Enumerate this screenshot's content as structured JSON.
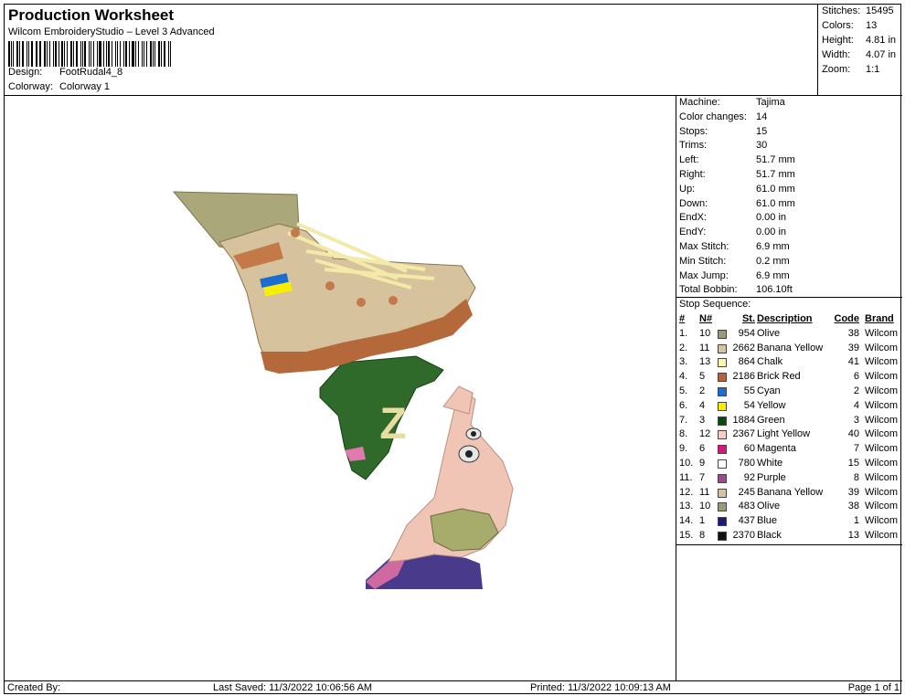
{
  "header": {
    "title": "Production Worksheet",
    "subtitle": "Wilcom EmbroideryStudio – Level 3 Advanced",
    "design_label": "Design:",
    "design_value": "FootRudal4_8",
    "colorway_label": "Colorway:",
    "colorway_value": "Colorway 1"
  },
  "stats": [
    {
      "label": "Stitches:",
      "value": "15495"
    },
    {
      "label": "Colors:",
      "value": "13"
    },
    {
      "label": "Height:",
      "value": "4.81 in"
    },
    {
      "label": "Width:",
      "value": "4.07 in"
    },
    {
      "label": "Zoom:",
      "value": "1:1"
    }
  ],
  "machine": [
    {
      "label": "Machine:",
      "value": "Tajima"
    },
    {
      "label": "Color changes:",
      "value": "14"
    },
    {
      "label": "Stops:",
      "value": "15"
    },
    {
      "label": "Trims:",
      "value": "30"
    },
    {
      "label": "Left:",
      "value": "51.7 mm"
    },
    {
      "label": "Right:",
      "value": "51.7 mm"
    },
    {
      "label": "Up:",
      "value": "61.0 mm"
    },
    {
      "label": "Down:",
      "value": "61.0 mm"
    },
    {
      "label": "EndX:",
      "value": "0.00 in"
    },
    {
      "label": "EndY:",
      "value": "0.00 in"
    },
    {
      "label": "Max Stitch:",
      "value": "6.9 mm"
    },
    {
      "label": "Min Stitch:",
      "value": "0.2 mm"
    },
    {
      "label": "Max Jump:",
      "value": "6.9 mm"
    },
    {
      "label": "Total Bobbin:",
      "value": "106.10ft"
    }
  ],
  "stop_sequence": {
    "title": "Stop Sequence:",
    "headers": {
      "num": "#",
      "n": "N#",
      "st": "St.",
      "desc": "Description",
      "code": "Code",
      "brand": "Brand"
    },
    "rows": [
      {
        "num": "1.",
        "n": "10",
        "color": "#9a9a78",
        "st": "954",
        "desc": "Olive",
        "code": "38",
        "brand": "Wilcom"
      },
      {
        "num": "2.",
        "n": "11",
        "color": "#d8c3a0",
        "st": "2662",
        "desc": "Banana Yellow",
        "code": "39",
        "brand": "Wilcom"
      },
      {
        "num": "3.",
        "n": "13",
        "color": "#fbf6a8",
        "st": "864",
        "desc": "Chalk",
        "code": "41",
        "brand": "Wilcom"
      },
      {
        "num": "4.",
        "n": "5",
        "color": "#b8643a",
        "st": "2186",
        "desc": "Brick Red",
        "code": "6",
        "brand": "Wilcom"
      },
      {
        "num": "5.",
        "n": "2",
        "color": "#1b6ed0",
        "st": "55",
        "desc": "Cyan",
        "code": "2",
        "brand": "Wilcom"
      },
      {
        "num": "6.",
        "n": "4",
        "color": "#f8ef00",
        "st": "54",
        "desc": "Yellow",
        "code": "4",
        "brand": "Wilcom"
      },
      {
        "num": "7.",
        "n": "3",
        "color": "#0a4a12",
        "st": "1884",
        "desc": "Green",
        "code": "3",
        "brand": "Wilcom"
      },
      {
        "num": "8.",
        "n": "12",
        "color": "#f7cdc6",
        "st": "2367",
        "desc": "Light Yellow",
        "code": "40",
        "brand": "Wilcom"
      },
      {
        "num": "9.",
        "n": "6",
        "color": "#d8157a",
        "st": "60",
        "desc": "Magenta",
        "code": "7",
        "brand": "Wilcom"
      },
      {
        "num": "10.",
        "n": "9",
        "color": "#ffffff",
        "st": "780",
        "desc": "White",
        "code": "15",
        "brand": "Wilcom"
      },
      {
        "num": "11.",
        "n": "7",
        "color": "#9a4a8a",
        "st": "92",
        "desc": "Purple",
        "code": "8",
        "brand": "Wilcom"
      },
      {
        "num": "12.",
        "n": "11",
        "color": "#d8c3a0",
        "st": "245",
        "desc": "Banana Yellow",
        "code": "39",
        "brand": "Wilcom"
      },
      {
        "num": "13.",
        "n": "10",
        "color": "#9a9a78",
        "st": "483",
        "desc": "Olive",
        "code": "38",
        "brand": "Wilcom"
      },
      {
        "num": "14.",
        "n": "1",
        "color": "#1e1a78",
        "st": "437",
        "desc": "Blue",
        "code": "1",
        "brand": "Wilcom"
      },
      {
        "num": "15.",
        "n": "8",
        "color": "#111111",
        "st": "2370",
        "desc": "Black",
        "code": "13",
        "brand": "Wilcom"
      }
    ]
  },
  "footer": {
    "created_by": "Created By:",
    "last_saved": "Last Saved: 11/3/2022 10:06:56 AM",
    "printed": "Printed: 11/3/2022 10:09:13 AM",
    "page": "Page 1 of 1"
  },
  "design_image": {
    "z_letter": "Z"
  }
}
